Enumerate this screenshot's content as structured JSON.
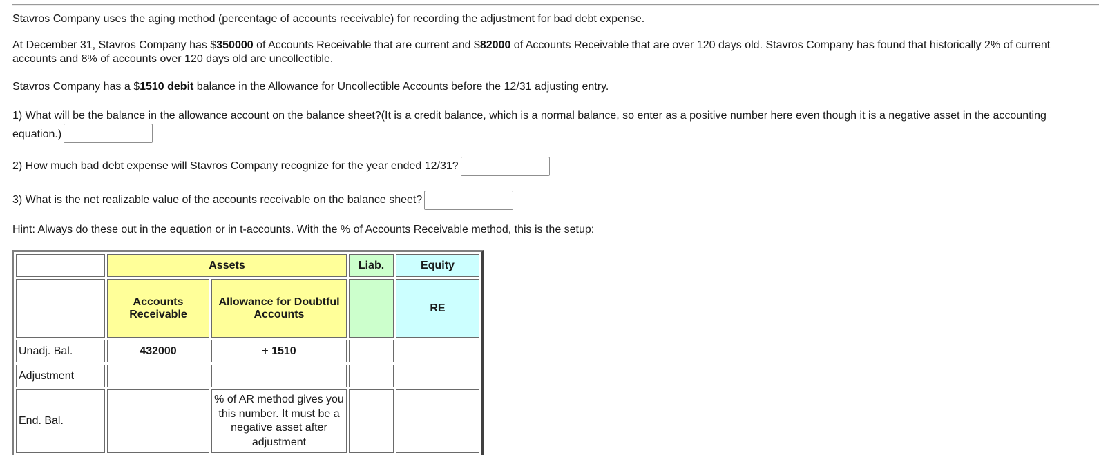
{
  "problem": {
    "intro": "Stavros Company uses the aging method (percentage of accounts receivable) for recording the adjustment for bad debt expense.",
    "facts": {
      "part1": "At December 31, Stavros Company has $",
      "current_ar": "350000",
      "part2": " of Accounts Receivable that are current and $",
      "old_ar": "82000",
      "part3": " of Accounts Receivable that are over 120 days old. Stavros Company has found that historically 2% of current accounts and 8% of accounts over 120 days old are uncollectible."
    },
    "allowance": {
      "part1": "Stavros Company has a $",
      "amount": "1510 debit",
      "part2": " balance in the Allowance for Uncollectible Accounts before the 12/31 adjusting entry."
    }
  },
  "questions": [
    {
      "text": "1) What will be the balance in the allowance account on the balance sheet?(It is a credit balance, which is a normal balance, so enter as a positive number here even though it is a negative asset in the accounting equation.)",
      "value": ""
    },
    {
      "text": "2) How much bad debt expense will Stavros Company recognize for the year ended 12/31?",
      "value": ""
    },
    {
      "text": "3) What is the net realizable value of the accounts receivable on the balance sheet?",
      "value": ""
    }
  ],
  "hint": "Hint: Always do these out in the equation or in t-accounts. With the % of Accounts Receivable method, this is the setup:",
  "setup_table": {
    "colors": {
      "assets": "#ffff99",
      "liabilities": "#ccffcc",
      "equity": "#ccffff"
    },
    "group_headers": {
      "assets": "Assets",
      "liabilities": "Liab.",
      "equity": "Equity"
    },
    "column_headers": {
      "accounts_receivable": "Accounts Receivable",
      "allowance": "Allowance for Doubtful Accounts",
      "liabilities": "",
      "equity": "RE"
    },
    "rows": [
      {
        "label": "Unadj. Bal.",
        "accounts_receivable": "432000",
        "allowance": "+ 1510",
        "liabilities": "",
        "equity": ""
      },
      {
        "label": "Adjustment",
        "accounts_receivable": "",
        "allowance": "",
        "liabilities": "",
        "equity": ""
      },
      {
        "label": "End. Bal.",
        "accounts_receivable": "",
        "allowance": "% of AR method gives you this number. It must be a negative asset after adjustment",
        "liabilities": "",
        "equity": ""
      }
    ]
  }
}
